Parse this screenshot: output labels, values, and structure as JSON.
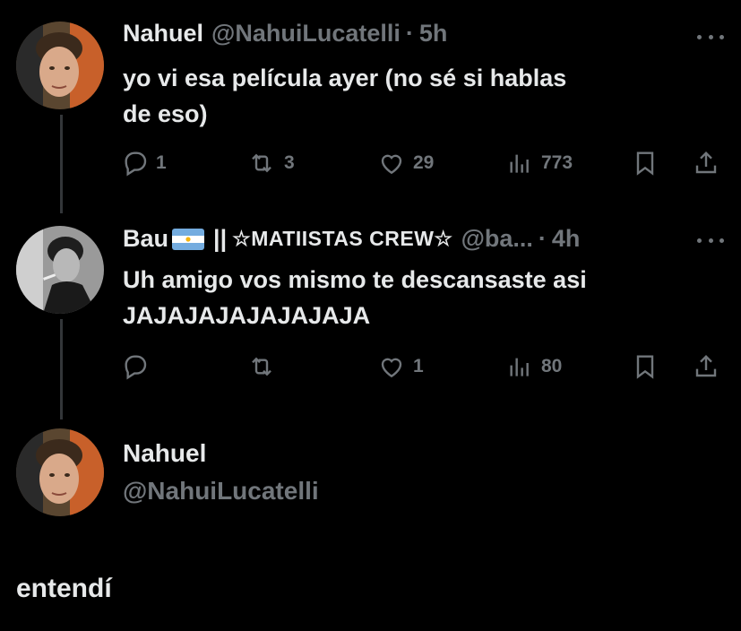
{
  "tweets": [
    {
      "name": "Nahuel",
      "handle": "@NahuiLucatelli",
      "dot": "·",
      "time": "5h",
      "lines": [
        "yo vi esa película ayer (no sé si hablas",
        "de eso)"
      ],
      "replies": "1",
      "reposts": "3",
      "likes": "29",
      "views": "773"
    },
    {
      "name": "Bau",
      "separator": "||",
      "crew": "☆MATIISTAS CREW☆",
      "handle": "@ba...",
      "dot": "·",
      "time": "4h",
      "lines": [
        "Uh amigo vos mismo te descansaste asi",
        "JAJAJAJAJAJAJAJA"
      ],
      "replies": "",
      "reposts": "",
      "likes": "1",
      "views": "80"
    }
  ],
  "main_tweet": {
    "name": "Nahuel",
    "handle": "@NahuiLucatelli",
    "text": "entendí"
  },
  "colors": {
    "background": "#000000",
    "text": "#e7e9ea",
    "secondary": "#71767b",
    "thread_line": "#333639"
  },
  "icons": [
    "reply-icon",
    "repost-icon",
    "like-icon",
    "views-icon",
    "bookmark-icon",
    "share-icon",
    "more-icon",
    "argentina-flag"
  ]
}
